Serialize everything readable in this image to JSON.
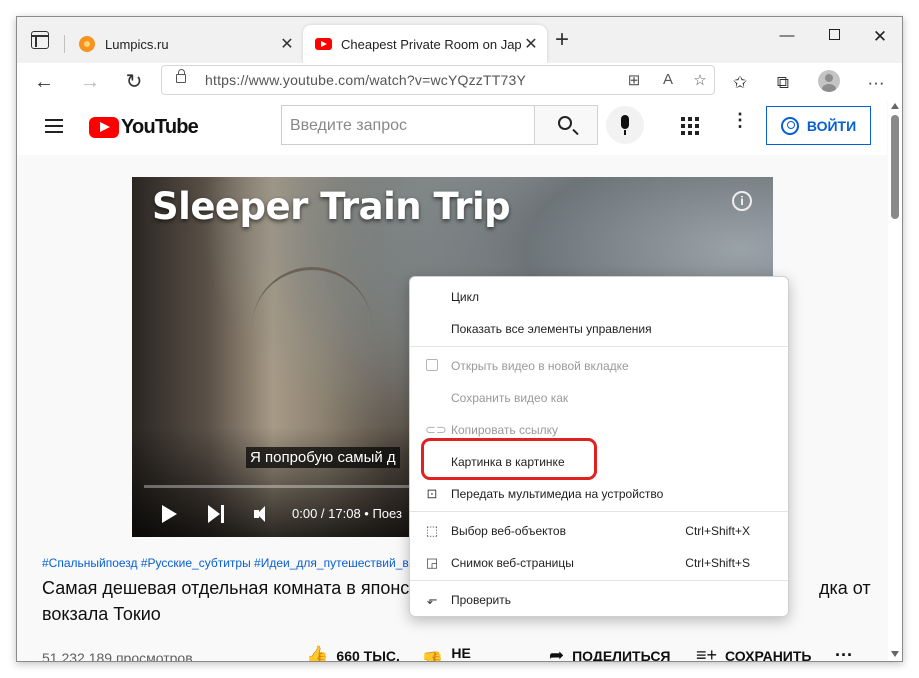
{
  "tabs": [
    {
      "title": "Lumpics.ru",
      "close": "✕"
    },
    {
      "title": "Cheapest Private Room on Japan",
      "close": "✕"
    }
  ],
  "new_tab": "+",
  "window_controls": {
    "minimize": "—",
    "close": "✕"
  },
  "nav": {
    "back": "←",
    "forward": "→",
    "reload": "↻"
  },
  "address": {
    "url": "https://www.youtube.com/watch?v=wcYQzzTT73Y"
  },
  "url_icons": {
    "reader": "⊞",
    "read_aloud": "A",
    "favorite": "☆"
  },
  "toolbar_icons": {
    "favorites": "✩",
    "collections": "⧉",
    "more": "···"
  },
  "youtube": {
    "logo_text": "YouTube",
    "search_placeholder": "Введите запрос",
    "signin_label": "ВОЙТИ",
    "kebab": "⋮"
  },
  "video": {
    "overlay_title": "Sleeper Train Trip",
    "info_icon": "i",
    "subtitle": "Я попробую самый д",
    "time": "0:00 / 17:08  •  Поез"
  },
  "details": {
    "hashtags": "#Спальныйпоезд #Русские_субтитры #Идеи_для_путешествий_в",
    "title_part1": "Самая дешевая отдельная комната в японском",
    "title_part2": "дка от",
    "title_line2": "вокзала Токио",
    "views": "51 232 189 просмотров..."
  },
  "actions": {
    "like_icon": "👍",
    "like_label": "660 ТЫС.",
    "dislike_icon": "👎",
    "dislike_label": "НЕ НРАВИТСЯ",
    "share_icon": "➦",
    "share_label": "ПОДЕЛИТЬСЯ",
    "save_icon": "≡+",
    "save_label": "СОХРАНИТЬ",
    "more": "···"
  },
  "context_menu": {
    "items": [
      {
        "label": "Цикл"
      },
      {
        "label": "Показать все элементы управления"
      },
      {
        "label": "Открыть видео в новой вкладке",
        "disabled": true
      },
      {
        "label": "Сохранить видео как",
        "disabled": true
      },
      {
        "label": "Копировать ссылку",
        "disabled": true
      },
      {
        "label": "Картинка в картинке"
      },
      {
        "label": "Передать мультимедиа на устройство"
      },
      {
        "label": "Выбор веб-объектов",
        "shortcut": "Ctrl+Shift+X"
      },
      {
        "label": "Снимок веб-страницы",
        "shortcut": "Ctrl+Shift+S"
      },
      {
        "label": "Проверить"
      }
    ]
  },
  "colors": {
    "highlight": "#e0211f",
    "yt_red": "#ff0000",
    "link_blue": "#065fd4"
  }
}
